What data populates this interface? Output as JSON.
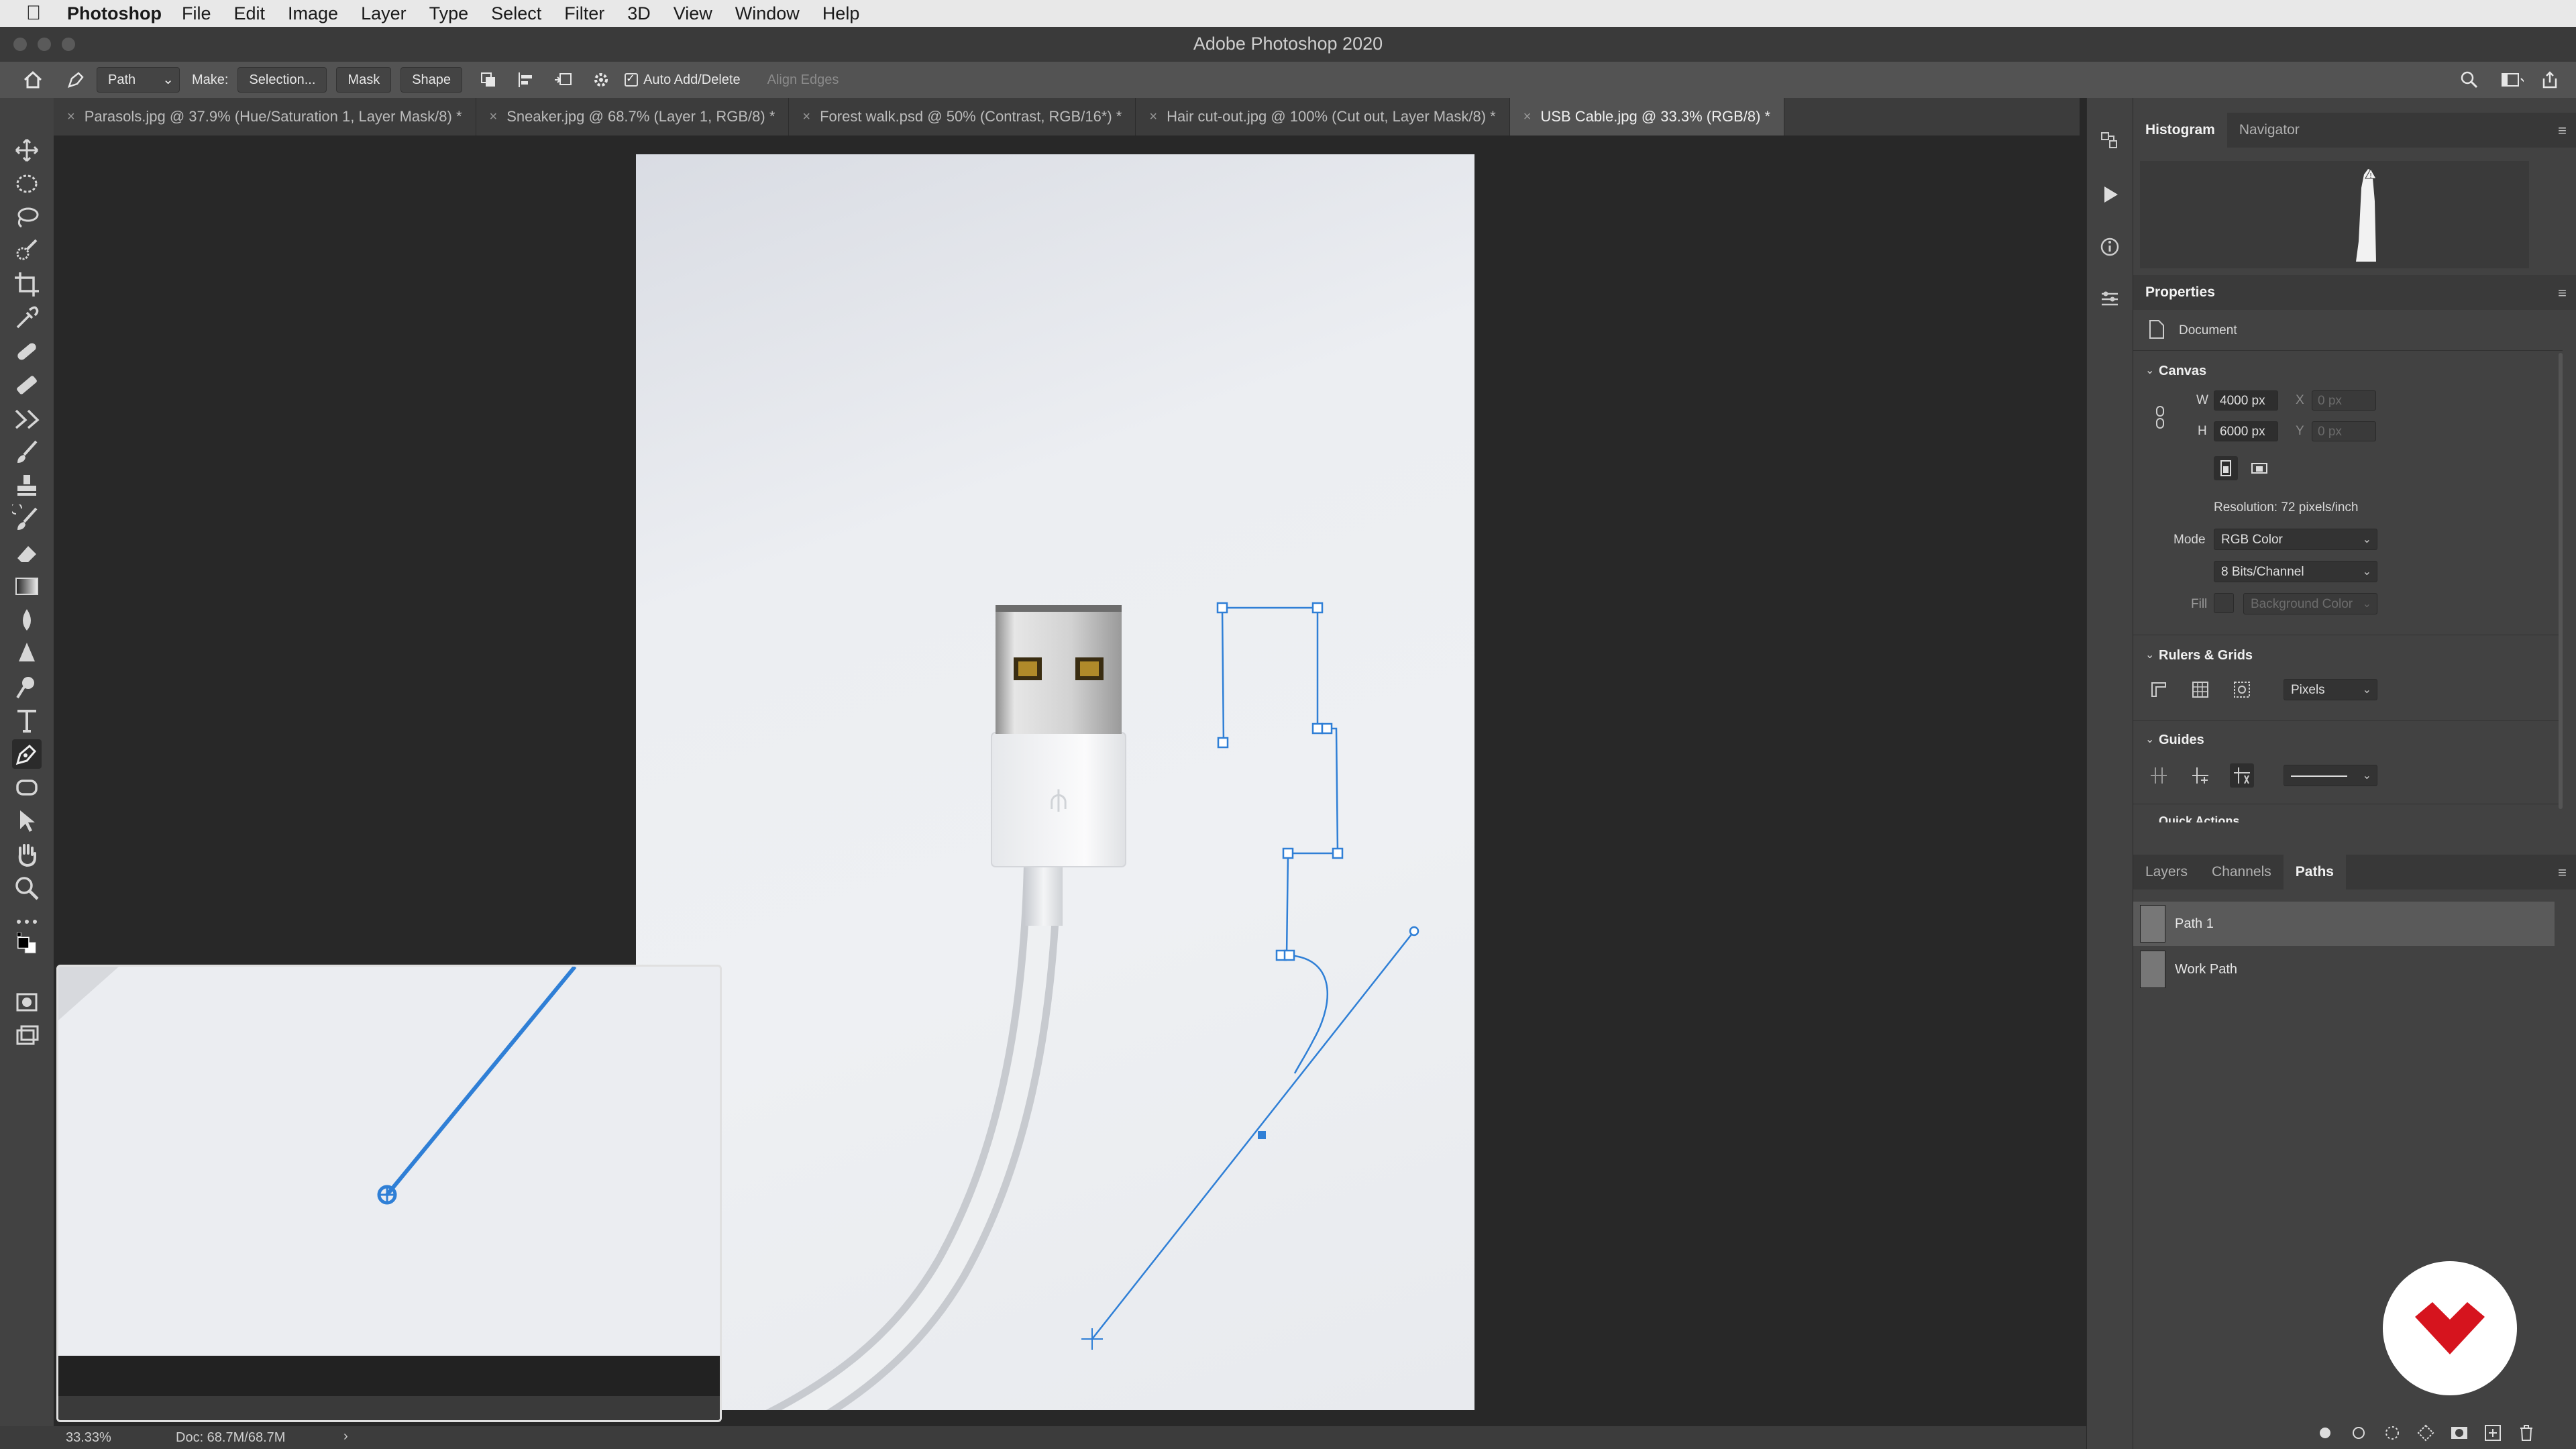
{
  "menubar": {
    "apple": "",
    "app": "Photoshop",
    "items": [
      "File",
      "Edit",
      "Image",
      "Layer",
      "Type",
      "Select",
      "Filter",
      "3D",
      "View",
      "Window",
      "Help"
    ]
  },
  "window": {
    "title": "Adobe Photoshop 2020"
  },
  "options": {
    "mode_value": "Path",
    "make_label": "Make:",
    "selection_btn": "Selection...",
    "mask_btn": "Mask",
    "shape_btn": "Shape",
    "auto_add_delete": "Auto Add/Delete",
    "align_edges": "Align Edges"
  },
  "tabs": [
    {
      "label": "Parasols.jpg @ 37.9% (Hue/Saturation 1, Layer Mask/8) *"
    },
    {
      "label": "Sneaker.jpg @ 68.7% (Layer 1, RGB/8) *"
    },
    {
      "label": "Forest walk.psd @ 50% (Contrast, RGB/16*) *"
    },
    {
      "label": "Hair cut-out.jpg @ 100% (Cut out, Layer Mask/8) *"
    },
    {
      "label": "USB Cable.jpg @ 33.3% (RGB/8) *"
    }
  ],
  "status": {
    "zoom": "33.33%",
    "doc": "Doc: 68.7M/68.7M",
    "arrow": "›"
  },
  "panels": {
    "top_tabs": [
      "Histogram",
      "Navigator"
    ],
    "properties_title": "Properties",
    "document_label": "Document",
    "canvas": {
      "title": "Canvas",
      "w_label": "W",
      "w_value": "4000 px",
      "h_label": "H",
      "h_value": "6000 px",
      "x_label": "X",
      "x_value": "0 px",
      "y_label": "Y",
      "y_value": "0 px",
      "resolution": "Resolution: 72 pixels/inch",
      "mode_label": "Mode",
      "mode_value": "RGB Color",
      "depth_value": "8 Bits/Channel",
      "fill_label": "Fill",
      "fill_value": "Background Color"
    },
    "rulers": {
      "title": "Rulers & Grids",
      "units": "Pixels"
    },
    "guides": {
      "title": "Guides"
    },
    "quick_actions": {
      "title": "Quick Actions"
    },
    "bottom_tabs": [
      "Layers",
      "Channels",
      "Paths"
    ],
    "paths": [
      {
        "label": "Path 1"
      },
      {
        "label": "Work Path"
      }
    ]
  },
  "colors": {
    "accent": "#3a7bd5",
    "path_blue": "#2f7fd6",
    "logo_red": "#d6141e"
  },
  "icons": [
    "home-icon",
    "pen-tool-icon",
    "search-icon",
    "workspace-icon",
    "share-icon",
    "gear-icon",
    "histogram-icon",
    "play-icon",
    "info-icon",
    "properties-icon",
    "link-icon",
    "fill-circle-icon",
    "stroke-circle-icon",
    "selection-load-icon",
    "mask-icon",
    "new-path-icon",
    "trash-icon"
  ]
}
